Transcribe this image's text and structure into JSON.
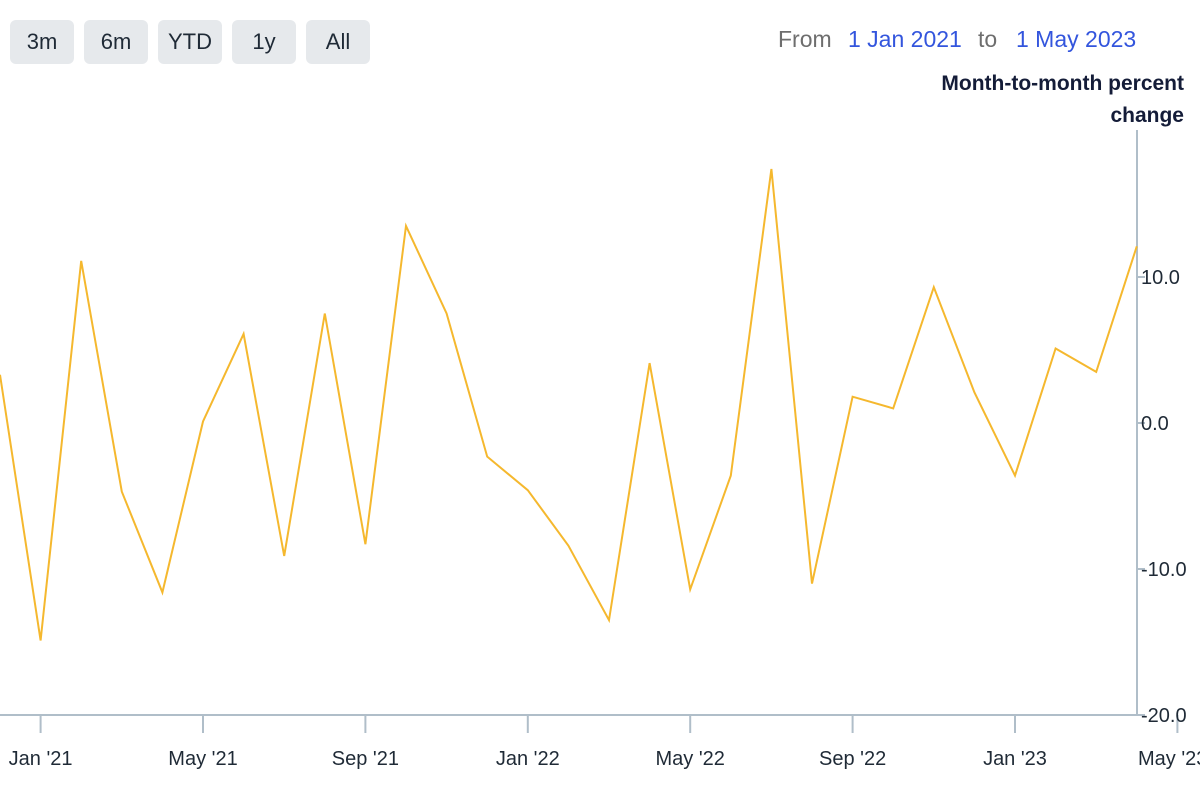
{
  "range_selector": {
    "buttons": [
      "3m",
      "6m",
      "YTD",
      "1y",
      "All"
    ]
  },
  "date_range": {
    "from_label": "From",
    "from_value": "1 Jan 2021",
    "to_label": "to",
    "to_value": "1 May 2023"
  },
  "colors": {
    "series": "#f5b82e",
    "axis": "#b0bec9",
    "accent": "#3355dd"
  },
  "chart_data": {
    "type": "line",
    "title": "",
    "ylabel": "Month-to-month percent change",
    "y_axis_position": "right",
    "ylim": [
      -20,
      20
    ],
    "yticks": [
      -20,
      -10,
      0,
      10
    ],
    "ytick_labels": [
      "-20.0",
      "-10.0",
      "0.0",
      "10.0"
    ],
    "xtick_labels": [
      "Jan '21",
      "May '21",
      "Sep '21",
      "Jan '22",
      "May '22",
      "Sep '22",
      "Jan '23",
      "May '23"
    ],
    "x": [
      "2020-12",
      "2021-01",
      "2021-02",
      "2021-03",
      "2021-04",
      "2021-05",
      "2021-06",
      "2021-07",
      "2021-08",
      "2021-09",
      "2021-10",
      "2021-11",
      "2021-12",
      "2022-01",
      "2022-02",
      "2022-03",
      "2022-04",
      "2022-05",
      "2022-06",
      "2022-07",
      "2022-08",
      "2022-09",
      "2022-10",
      "2022-11",
      "2022-12",
      "2023-01",
      "2023-02",
      "2023-03",
      "2023-04",
      "2023-05"
    ],
    "series": [
      {
        "values": [
          3.3,
          -14.9,
          11.1,
          -4.7,
          -11.6,
          0.1,
          6.1,
          -9.1,
          7.5,
          -8.3,
          13.5,
          7.5,
          -2.3,
          -4.6,
          -8.4,
          -13.5,
          4.1,
          -11.4,
          -3.6,
          17.4,
          -11.0,
          1.8,
          1.0,
          9.3,
          2.1,
          -3.6,
          5.1,
          3.5,
          12.1
        ]
      }
    ],
    "grid": false,
    "legend": "none"
  }
}
